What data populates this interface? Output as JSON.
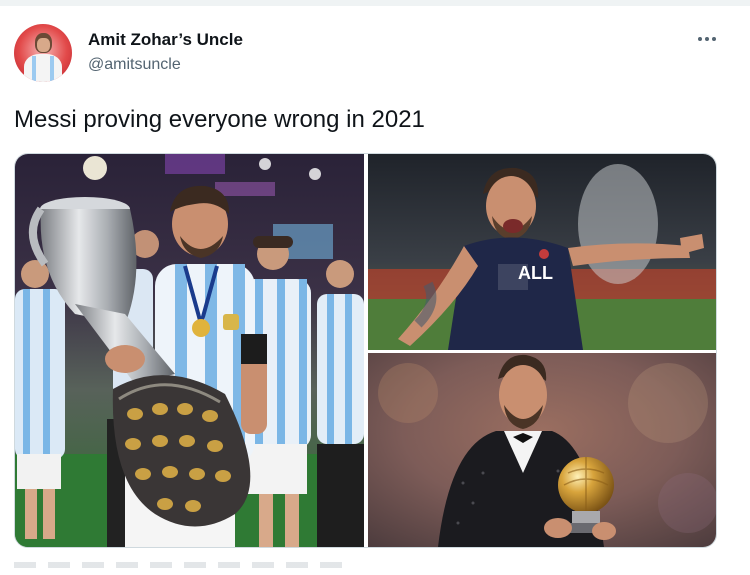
{
  "user": {
    "display_name": "Amit Zohar’s Uncle",
    "handle": "@amitsuncle",
    "avatar_icon": "profile-avatar"
  },
  "tweet": {
    "text": "Messi proving everyone wrong in 2021"
  },
  "menu": {
    "icon": "more-options-icon"
  },
  "media": {
    "photo_left_icon": "copa-america-trophy-photo",
    "photo_top_right_icon": "psg-celebration-photo",
    "photo_bottom_right_icon": "ballon-dor-photo",
    "jersey_text": "ALL"
  },
  "colors": {
    "text_primary": "#0f1419",
    "text_secondary": "#536471",
    "border": "#cfd9de"
  }
}
